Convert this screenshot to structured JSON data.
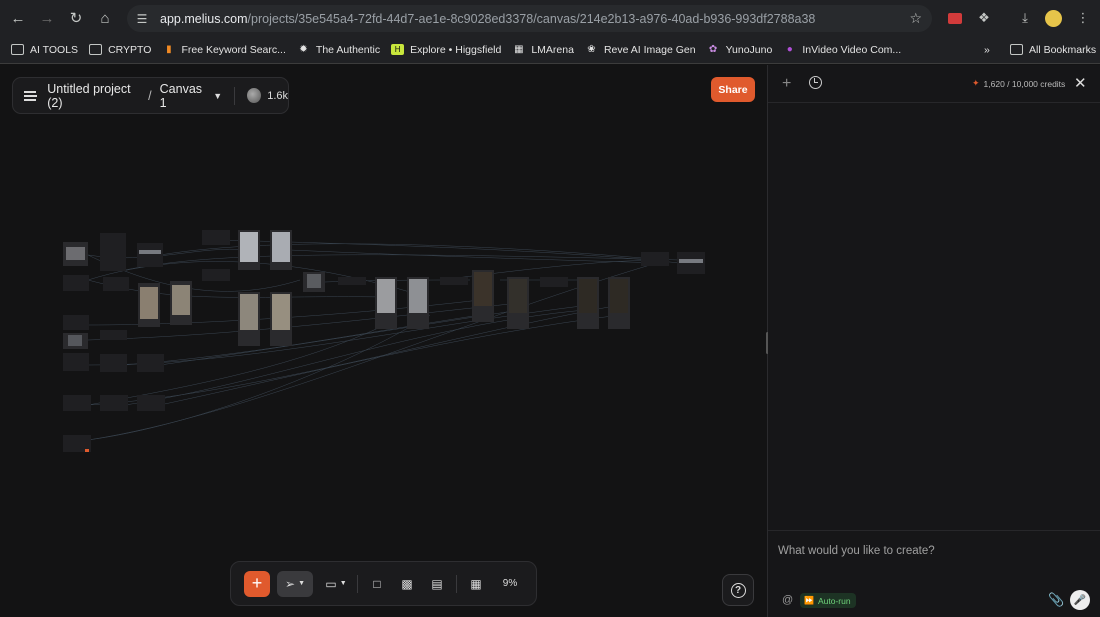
{
  "browser": {
    "url_host": "app.melius.com",
    "url_path": "/projects/35e545a4-72fd-44d7-ae1e-8c9028ed3378/canvas/214e2b13-a976-40ad-b936-993df2788a38",
    "bookmarks": [
      {
        "label": "AI TOOLS",
        "icon": "folder-icon"
      },
      {
        "label": "CRYPTO",
        "icon": "folder-icon"
      },
      {
        "label": "Free Keyword Searc...",
        "icon": "bars-icon"
      },
      {
        "label": "The Authentic",
        "icon": "sparkle-icon"
      },
      {
        "label": "Explore • Higgsfield",
        "icon": "higgsfield-icon"
      },
      {
        "label": "LMArena",
        "icon": "grid-icon"
      },
      {
        "label": "Reve AI Image Gen",
        "icon": "reve-icon"
      },
      {
        "label": "YunoJuno",
        "icon": "flower-icon"
      },
      {
        "label": "InVideo Video Com...",
        "icon": "invideo-icon"
      }
    ],
    "all_bookmarks_label": "All Bookmarks"
  },
  "header": {
    "project_title": "Untitled project (2)",
    "separator": "/",
    "canvas_name": "Canvas 1",
    "coin_count": "1.6k",
    "share_label": "Share"
  },
  "toolbar": {
    "zoom": "9%"
  },
  "sidebar": {
    "credits": "1,620 / 10,000 credits",
    "prompt_placeholder": "What would you like to create?",
    "at_symbol": "@",
    "autorun_label": "Auto-run"
  },
  "colors": {
    "accent": "#e05a2d",
    "canvas_bg": "#131314",
    "node_bg": "#1f1f22",
    "autorun_green": "#6fd27a"
  }
}
